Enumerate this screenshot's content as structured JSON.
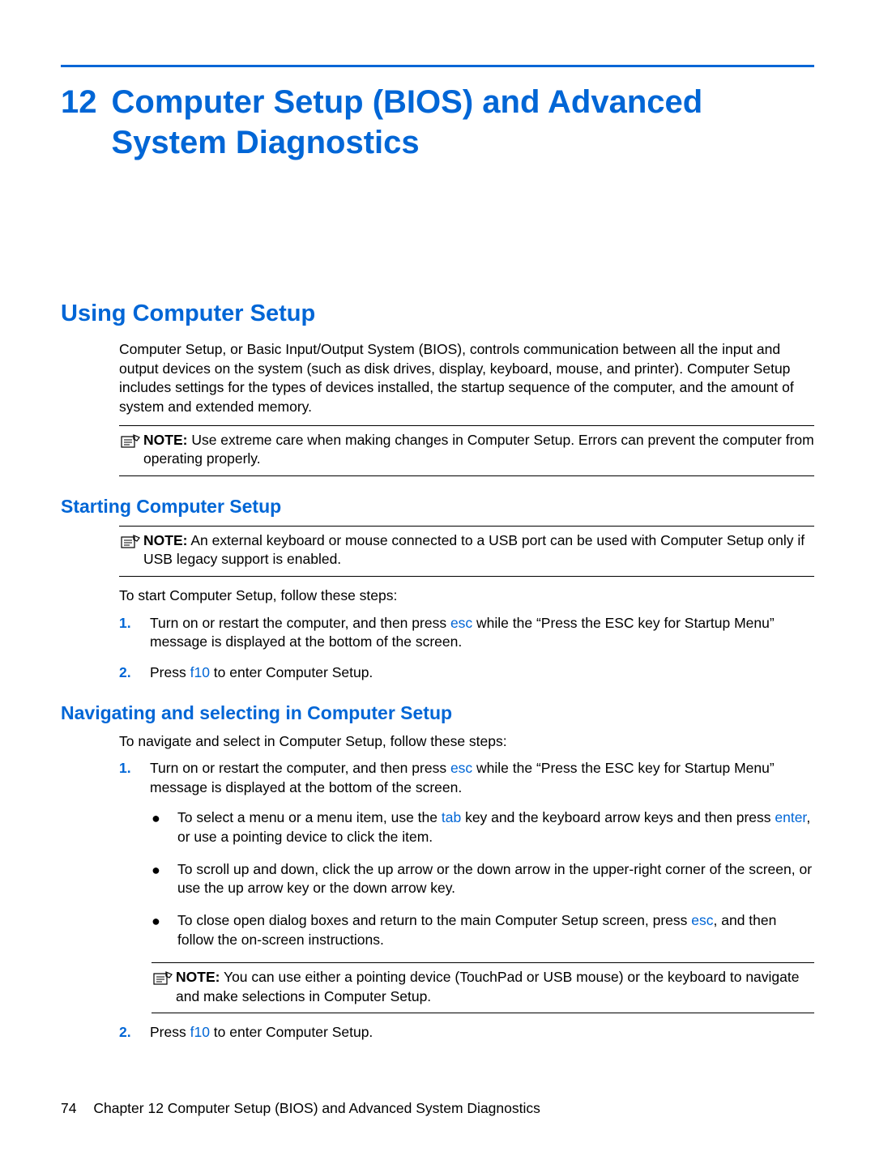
{
  "chapter": {
    "number": "12",
    "title": "Computer Setup (BIOS) and Advanced System Diagnostics"
  },
  "section1": {
    "heading": "Using Computer Setup",
    "intro": "Computer Setup, or Basic Input/Output System (BIOS), controls communication between all the input and output devices on the system (such as disk drives, display, keyboard, mouse, and printer). Computer Setup includes settings for the types of devices installed, the startup sequence of the computer, and the amount of system and extended memory.",
    "note1_label": "NOTE:",
    "note1_text": "Use extreme care when making changes in Computer Setup. Errors can prevent the computer from operating properly."
  },
  "section2": {
    "heading": "Starting Computer Setup",
    "note_label": "NOTE:",
    "note_text": "An external keyboard or mouse connected to a USB port can be used with Computer Setup only if USB legacy support is enabled.",
    "intro": "To start Computer Setup, follow these steps:",
    "step1_a": "Turn on or restart the computer, and then press ",
    "step1_key": "esc",
    "step1_b": " while the “Press the ESC key for Startup Menu” message is displayed at the bottom of the screen.",
    "step2_a": "Press ",
    "step2_key": "f10",
    "step2_b": " to enter Computer Setup."
  },
  "section3": {
    "heading": "Navigating and selecting in Computer Setup",
    "intro": "To navigate and select in Computer Setup, follow these steps:",
    "step1_a": "Turn on or restart the computer, and then press ",
    "step1_key": "esc",
    "step1_b": " while the “Press the ESC key for Startup Menu” message is displayed at the bottom of the screen.",
    "bullet1_a": "To select a menu or a menu item, use the ",
    "bullet1_key1": "tab",
    "bullet1_b": " key and the keyboard arrow keys and then press ",
    "bullet1_key2": "enter",
    "bullet1_c": ", or use a pointing device to click the item.",
    "bullet2": "To scroll up and down, click the up arrow or the down arrow in the upper-right corner of the screen, or use the up arrow key or the down arrow key.",
    "bullet3_a": "To close open dialog boxes and return to the main Computer Setup screen, press ",
    "bullet3_key": "esc",
    "bullet3_b": ", and then follow the on-screen instructions.",
    "note_label": "NOTE:",
    "note_text": "You can use either a pointing device (TouchPad or USB mouse) or the keyboard to navigate and make selections in Computer Setup.",
    "step2_a": "Press ",
    "step2_key": "f10",
    "step2_b": " to enter Computer Setup."
  },
  "footer": {
    "page": "74",
    "text": "Chapter 12   Computer Setup (BIOS) and Advanced System Diagnostics"
  },
  "labels": {
    "num1": "1.",
    "num2": "2."
  }
}
